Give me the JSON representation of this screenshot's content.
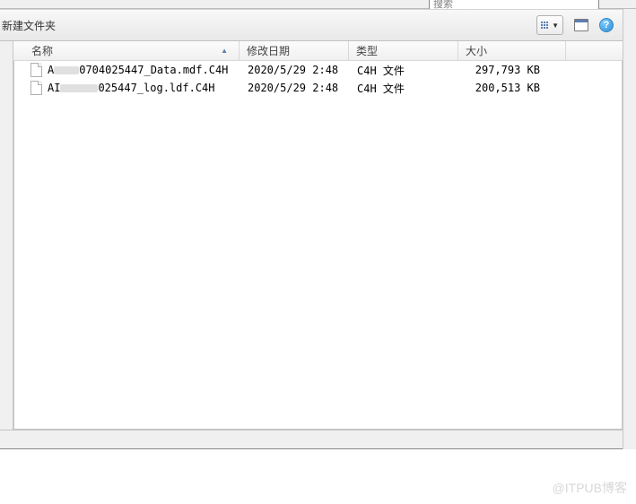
{
  "search": {
    "placeholder": "搜索"
  },
  "toolbar": {
    "new_folder": "新建文件夹"
  },
  "columns": {
    "name": "名称",
    "date": "修改日期",
    "type": "类型",
    "size": "大小"
  },
  "files": [
    {
      "prefix": "A",
      "suffix": "0704025447_Data.mdf.C4H",
      "date": "2020/5/29 2:48",
      "type": "C4H 文件",
      "size": "297,793 KB"
    },
    {
      "prefix": "AI",
      "suffix": "025447_log.ldf.C4H",
      "date": "2020/5/29 2:48",
      "type": "C4H 文件",
      "size": "200,513 KB"
    }
  ],
  "watermark": "@ITPUB博客"
}
